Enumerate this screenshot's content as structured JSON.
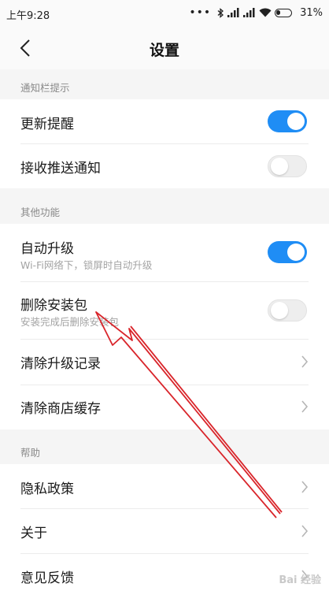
{
  "status_bar": {
    "time": "上午9:28",
    "battery": "31%"
  },
  "header": {
    "title": "设置"
  },
  "sections": {
    "notify": {
      "label": "通知栏提示",
      "update_reminder": {
        "title": "更新提醒",
        "enabled": true
      },
      "push": {
        "title": "接收推送通知",
        "enabled": false
      }
    },
    "other": {
      "label": "其他功能",
      "auto_upgrade": {
        "title": "自动升级",
        "subtitle": "Wi-Fi网络下，锁屏时自动升级",
        "enabled": true
      },
      "delete_pkg": {
        "title": "删除安装包",
        "subtitle": "安装完成后删除安装包",
        "enabled": false
      },
      "clear_records": {
        "title": "清除升级记录"
      },
      "clear_cache": {
        "title": "清除商店缓存"
      }
    },
    "help": {
      "label": "帮助",
      "privacy": {
        "title": "隐私政策"
      },
      "about": {
        "title": "关于"
      },
      "feedback": {
        "title": "意见反馈"
      }
    }
  },
  "colors": {
    "toggle_on": "#1f8df5",
    "annotation_arrow": "#d9252b"
  },
  "watermark": "Bai 经验"
}
